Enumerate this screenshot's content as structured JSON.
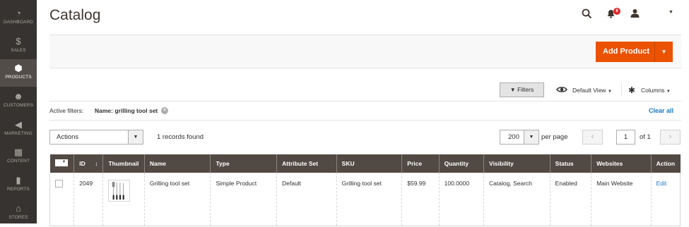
{
  "nav": [
    {
      "label": "DASHBOARD",
      "icon": "speedometer-icon",
      "glyph": "◔"
    },
    {
      "label": "SALES",
      "icon": "dollar-icon",
      "glyph": "$"
    },
    {
      "label": "PRODUCTS",
      "icon": "cube-icon",
      "glyph": "⬢"
    },
    {
      "label": "CUSTOMERS",
      "icon": "person-icon",
      "glyph": "☻"
    },
    {
      "label": "MARKETING",
      "icon": "megaphone-icon",
      "glyph": "◀"
    },
    {
      "label": "CONTENT",
      "icon": "layout-icon",
      "glyph": "▦"
    },
    {
      "label": "REPORTS",
      "icon": "bar-chart-icon",
      "glyph": "▮"
    },
    {
      "label": "STORES",
      "icon": "store-icon",
      "glyph": "⌂"
    }
  ],
  "page_title": "Catalog",
  "header": {
    "notification_count": "8"
  },
  "actions": {
    "add_product": "Add Product"
  },
  "toolbar": {
    "filters": "Filters",
    "default_view": "Default View",
    "columns": "Columns"
  },
  "active_filters": {
    "label": "Active filters:",
    "chip": "Name: grilling tool set",
    "clear_all": "Clear all"
  },
  "mass_actions": {
    "label": "Actions"
  },
  "records_found": "1 records found",
  "pager": {
    "per_page_value": "200",
    "per_page_label": "per page",
    "current_page": "1",
    "of_pages": "of 1"
  },
  "grid": {
    "columns": [
      "ID",
      "Thumbnail",
      "Name",
      "Type",
      "Attribute Set",
      "SKU",
      "Price",
      "Quantity",
      "Visibility",
      "Status",
      "Websites",
      "Action"
    ],
    "row": {
      "id": "2049",
      "name": "Grilling tool set",
      "type": "Simple Product",
      "attribute_set": "Default",
      "sku": "Grilling tool set",
      "price": "$59.99",
      "quantity": "100.0000",
      "visibility": "Catalog, Search",
      "status": "Enabled",
      "websites": "Main Website",
      "action": "Edit"
    }
  },
  "colors": {
    "accent": "#eb5202",
    "sidebar": "#373330",
    "grid_header": "#514943",
    "link": "#1979c3"
  }
}
